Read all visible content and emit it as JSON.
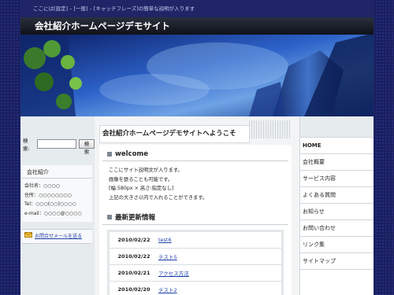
{
  "site": {
    "tagline": "ここには[設定] – [一般] – [キャッチフレーズ]の簡単な説明が入ります",
    "title": "会社紹介ホームページデモサイト"
  },
  "search": {
    "label": "検索:",
    "value": "",
    "button": "検索"
  },
  "company": {
    "heading": "会社紹介",
    "lines": [
      "会社名：○○○○",
      "住所：○○○○○○○○",
      "Tel：○○○(○○)○○○○",
      "e-mail：○○○○@○○○○"
    ]
  },
  "mail": {
    "label": "お問合せメールを送る"
  },
  "main": {
    "page_title": "会社紹介ホームページデモサイトへようこそ",
    "welcome_heading": "welcome",
    "welcome_lines": [
      "ここにサイト説明文が入ります。",
      "画像を張ることも可能です。",
      "[幅:580px × 高さ:指定なし]",
      "上記の大きさ以内で入れることができます。"
    ],
    "news_heading": "最新更新情報",
    "news": [
      {
        "date": "2010/02/22",
        "title": "test6"
      },
      {
        "date": "2010/02/22",
        "title": "テスト5"
      },
      {
        "date": "2010/02/21",
        "title": "アクセス方法"
      },
      {
        "date": "2010/02/20",
        "title": "テスト2"
      }
    ]
  },
  "nav": {
    "items": [
      "HOME",
      "会社概要",
      "サービス内容",
      "よくある質問",
      "お知らせ",
      "お問い合わせ",
      "リンク集",
      "サイトマップ"
    ]
  },
  "colors": {
    "background": "#1a1f5e",
    "topbar": "#1f2566",
    "link": "#1c3fa8"
  }
}
